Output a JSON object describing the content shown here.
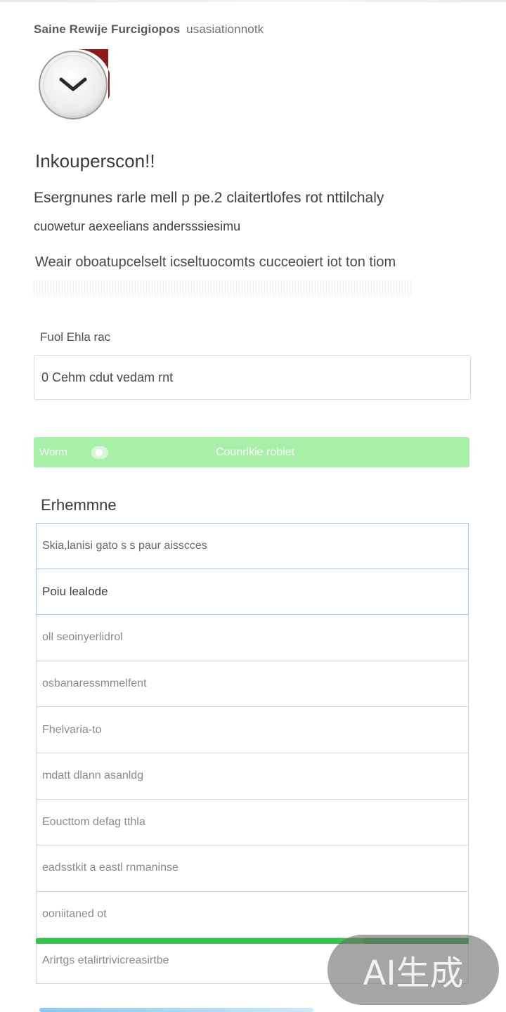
{
  "header": {
    "title": "Saine Rewije Furcigiopos",
    "subtitle": "usasiationnotk"
  },
  "logo": {
    "icon": "chevron-down-icon",
    "accent_color": "#8b1a1a"
  },
  "intro": {
    "title": "Inkouperscon!!",
    "description_line1": "Esergnunes rarle mell p pe.2 claitertlofes rot nttilchaly",
    "description_line2": "cuowetur aexeelians andersssiesimu"
  },
  "note": {
    "text": "Weair oboatupcelselt icseltuocomts cucceoiert iot ton tiom"
  },
  "field": {
    "label": "Fuol Ehla rac",
    "value": "0 Cehm cdut vedam rnt"
  },
  "action_bar": {
    "toggle_label": "Worm",
    "button_label": "Counrlkie roblet",
    "color": "#a8f0a8"
  },
  "section": {
    "title": "Erhemmne",
    "items": [
      "Skia,lanisi gato s s paur aisscces",
      "Poiu lealode",
      "oll seoinyerlidrol",
      "osbanaressmmelfent",
      "Fhelvaria-to",
      "mdatt dlann asanldg",
      "Eoucttom defag tthla",
      "eadsstkit a eastl rnmaninse",
      "ooniitaned ot",
      "Arirtgs etalirtrivicreasirtbe"
    ]
  },
  "progress": {
    "value": 1.0,
    "color": "#33c44a"
  },
  "watermark": {
    "text": "AI生成"
  }
}
